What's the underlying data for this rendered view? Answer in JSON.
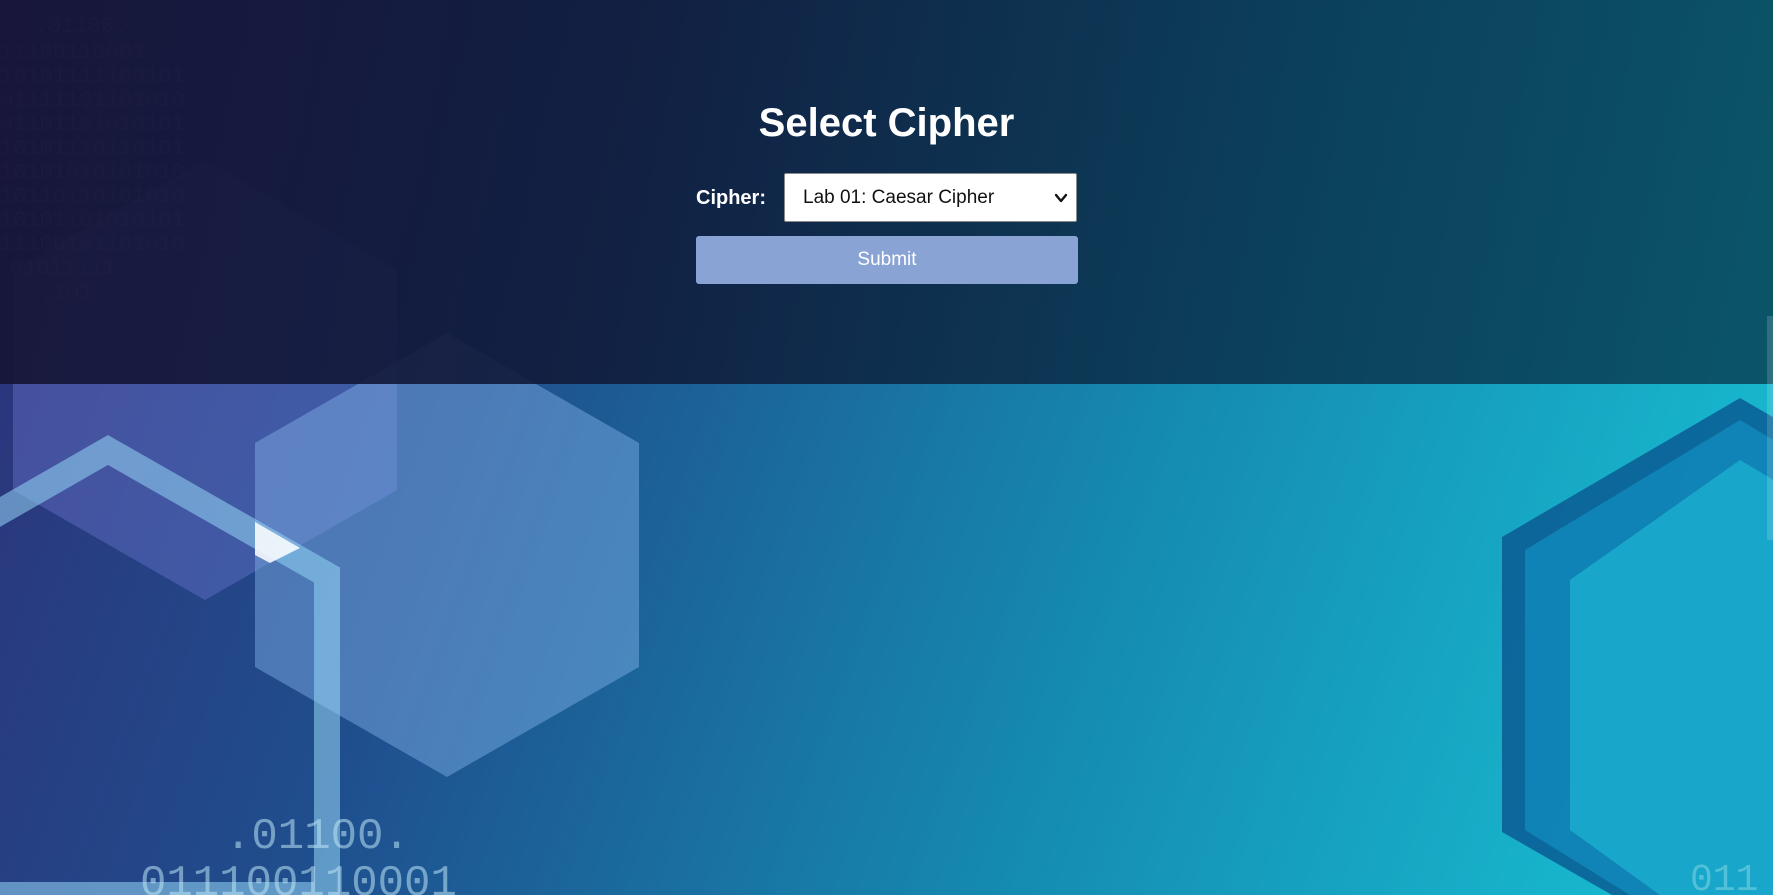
{
  "page": {
    "title": "Select Cipher"
  },
  "form": {
    "cipher_label": "Cipher:",
    "cipher_select": {
      "selected": "Lab 01: Caesar Cipher"
    },
    "submit_label": "Submit"
  },
  "colors": {
    "submit_button": "#8aa3d5",
    "overlay": "#161436",
    "accent_teal": "#18c3d6",
    "accent_purple": "#2e2f78"
  }
}
